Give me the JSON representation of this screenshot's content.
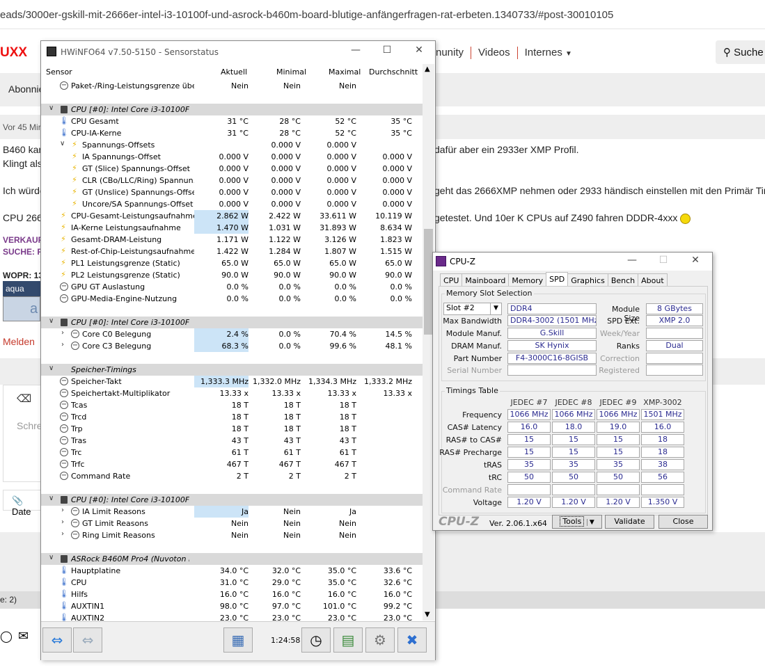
{
  "browser": {
    "url": "eads/3000er-gskill-mit-2666er-intel-i3-10100f-und-asrock-b460m-board-blutige-anfängerfragen-rat-erbeten.1340733/#post-30010105"
  },
  "site": {
    "logo": "UXX",
    "nav": [
      "nunity",
      "Videos",
      "Internes"
    ],
    "search_label": "Suche",
    "abonnie": "Abonnie",
    "post_meta": "Vor 45 Mir",
    "p1a": "B460 kan",
    "p1b": "dafür aber ein 2933er XMP Profil.",
    "p2": "Klingt als",
    "p3a": "Ich würde",
    "p3b": "geht das 2666XMP nehmen oder 2933 händisch einstellen mit den Primär Tim",
    "p4a": "CPU 2666",
    "p4b": "getestet. Und 10er K CPUs auf Z490 fahren DDDR-4xxx",
    "verkauf": "VERKAUF:",
    "suche": "SUCHE: R",
    "wopr": "WOPR: 13",
    "badge": "aqua",
    "badge2": "a",
    "melden": "Melden",
    "schre": "Schre",
    "date": "Date",
    "count": "e: 2)"
  },
  "hwinfo": {
    "title": "HWiNFO64 v7.50-5150 - Sensorstatus",
    "columns": [
      "Sensor",
      "Aktuell",
      "Minimal",
      "Maximal",
      "Durchschnitt"
    ],
    "rows": [
      {
        "t": "min",
        "n": "Paket-/Ring-Leistungsgrenze übe...",
        "v": [
          "Nein",
          "Nein",
          "Nein",
          ""
        ]
      },
      {
        "t": "blank",
        "n": "",
        "v": [
          "",
          "",
          "",
          ""
        ]
      },
      {
        "t": "grp",
        "n": "CPU [#0]: Intel Core i3-10100F: ...",
        "v": [
          "",
          "",
          "",
          ""
        ]
      },
      {
        "t": "th",
        "n": "CPU Gesamt",
        "v": [
          "31 °C",
          "28 °C",
          "52 °C",
          "35 °C"
        ]
      },
      {
        "t": "th",
        "n": "CPU-IA-Kerne",
        "v": [
          "31 °C",
          "28 °C",
          "52 °C",
          "35 °C"
        ]
      },
      {
        "t": "sub",
        "n": "Spannungs-Offsets",
        "v": [
          "",
          "0.000 V",
          "0.000 V",
          ""
        ]
      },
      {
        "t": "bolt2",
        "n": "IA Spannungs-Offset",
        "v": [
          "0.000 V",
          "0.000 V",
          "0.000 V",
          "0.000 V"
        ]
      },
      {
        "t": "bolt2",
        "n": "GT (Slice) Spannungs-Offset",
        "v": [
          "0.000 V",
          "0.000 V",
          "0.000 V",
          "0.000 V"
        ]
      },
      {
        "t": "bolt2",
        "n": "CLR (CBo/LLC/Ring) Spannun...",
        "v": [
          "0.000 V",
          "0.000 V",
          "0.000 V",
          "0.000 V"
        ]
      },
      {
        "t": "bolt2",
        "n": "GT (Unslice) Spannungs-Offset",
        "v": [
          "0.000 V",
          "0.000 V",
          "0.000 V",
          "0.000 V"
        ]
      },
      {
        "t": "bolt2",
        "n": "Uncore/SA Spannungs-Offset",
        "v": [
          "0.000 V",
          "0.000 V",
          "0.000 V",
          "0.000 V"
        ]
      },
      {
        "t": "bolt",
        "n": "CPU-Gesamt-Leistungsaufnahme",
        "v": [
          "2.862 W",
          "2.422 W",
          "33.611 W",
          "10.119 W"
        ],
        "hl": true
      },
      {
        "t": "bolt",
        "n": "IA-Kerne Leistungsaufnahme",
        "v": [
          "1.470 W",
          "1.031 W",
          "31.893 W",
          "8.634 W"
        ],
        "hl": true
      },
      {
        "t": "bolt",
        "n": "Gesamt-DRAM-Leistung",
        "v": [
          "1.171 W",
          "1.122 W",
          "3.126 W",
          "1.823 W"
        ]
      },
      {
        "t": "bolt",
        "n": "Rest-of-Chip-Leistungsaufnahme",
        "v": [
          "1.422 W",
          "1.284 W",
          "1.807 W",
          "1.515 W"
        ]
      },
      {
        "t": "bolt",
        "n": "PL1 Leistungsgrenze (Static)",
        "v": [
          "65.0 W",
          "65.0 W",
          "65.0 W",
          "65.0 W"
        ]
      },
      {
        "t": "bolt",
        "n": "PL2 Leistungsgrenze (Static)",
        "v": [
          "90.0 W",
          "90.0 W",
          "90.0 W",
          "90.0 W"
        ]
      },
      {
        "t": "min",
        "n": "GPU GT Auslastung",
        "v": [
          "0.0 %",
          "0.0 %",
          "0.0 %",
          "0.0 %"
        ]
      },
      {
        "t": "min",
        "n": "GPU-Media-Engine-Nutzung",
        "v": [
          "0.0 %",
          "0.0 %",
          "0.0 %",
          "0.0 %"
        ]
      },
      {
        "t": "blank",
        "n": "",
        "v": [
          "",
          "",
          "",
          ""
        ]
      },
      {
        "t": "grp",
        "n": "CPU [#0]: Intel Core i3-10100F: ...",
        "v": [
          "",
          "",
          "",
          ""
        ]
      },
      {
        "t": "submin",
        "n": "Core C0 Belegung",
        "v": [
          "2.4 %",
          "0.0 %",
          "70.4 %",
          "14.5 %"
        ],
        "hl": true
      },
      {
        "t": "submin",
        "n": "Core C3 Belegung",
        "v": [
          "68.3 %",
          "0.0 %",
          "99.6 %",
          "48.1 %"
        ],
        "hl": true
      },
      {
        "t": "blank",
        "n": "",
        "v": [
          "",
          "",
          "",
          ""
        ]
      },
      {
        "t": "grp2",
        "n": "Speicher-Timings",
        "v": [
          "",
          "",
          "",
          ""
        ]
      },
      {
        "t": "min",
        "n": "Speicher-Takt",
        "v": [
          "1,333.3 MHz",
          "1,332.0 MHz",
          "1,334.3 MHz",
          "1,333.2 MHz"
        ],
        "hl": true
      },
      {
        "t": "min",
        "n": "Speichertakt-Multiplikator",
        "v": [
          "13.33 x",
          "13.33 x",
          "13.33 x",
          "13.33 x"
        ]
      },
      {
        "t": "min",
        "n": "Tcas",
        "v": [
          "18 T",
          "18 T",
          "18 T",
          ""
        ]
      },
      {
        "t": "min",
        "n": "Trcd",
        "v": [
          "18 T",
          "18 T",
          "18 T",
          ""
        ]
      },
      {
        "t": "min",
        "n": "Trp",
        "v": [
          "18 T",
          "18 T",
          "18 T",
          ""
        ]
      },
      {
        "t": "min",
        "n": "Tras",
        "v": [
          "43 T",
          "43 T",
          "43 T",
          ""
        ]
      },
      {
        "t": "min",
        "n": "Trc",
        "v": [
          "61 T",
          "61 T",
          "61 T",
          ""
        ]
      },
      {
        "t": "min",
        "n": "Trfc",
        "v": [
          "467 T",
          "467 T",
          "467 T",
          ""
        ]
      },
      {
        "t": "min",
        "n": "Command Rate",
        "v": [
          "2 T",
          "2 T",
          "2 T",
          ""
        ]
      },
      {
        "t": "blank",
        "n": "",
        "v": [
          "",
          "",
          "",
          ""
        ]
      },
      {
        "t": "grp",
        "n": "CPU [#0]: Intel Core i3-10100F: ...",
        "v": [
          "",
          "",
          "",
          ""
        ]
      },
      {
        "t": "submin",
        "n": "IA Limit Reasons",
        "v": [
          "Ja",
          "Nein",
          "Ja",
          ""
        ],
        "hl": true
      },
      {
        "t": "submin",
        "n": "GT Limit Reasons",
        "v": [
          "Nein",
          "Nein",
          "Nein",
          ""
        ]
      },
      {
        "t": "submin",
        "n": "Ring Limit Reasons",
        "v": [
          "Nein",
          "Nein",
          "Nein",
          ""
        ]
      },
      {
        "t": "blank",
        "n": "",
        "v": [
          "",
          "",
          "",
          ""
        ]
      },
      {
        "t": "grp",
        "n": "ASRock B460M Pro4 (Nuvoton NC...",
        "v": [
          "",
          "",
          "",
          ""
        ]
      },
      {
        "t": "th",
        "n": "Hauptplatine",
        "v": [
          "34.0 °C",
          "32.0 °C",
          "35.0 °C",
          "33.6 °C"
        ]
      },
      {
        "t": "th",
        "n": "CPU",
        "v": [
          "31.0 °C",
          "29.0 °C",
          "35.0 °C",
          "32.6 °C"
        ]
      },
      {
        "t": "th",
        "n": "Hilfs",
        "v": [
          "16.0 °C",
          "16.0 °C",
          "16.0 °C",
          "16.0 °C"
        ]
      },
      {
        "t": "th",
        "n": "AUXTIN1",
        "v": [
          "98.0 °C",
          "97.0 °C",
          "101.0 °C",
          "99.2 °C"
        ]
      },
      {
        "t": "th",
        "n": "AUXTIN2",
        "v": [
          "23.0 °C",
          "23.0 °C",
          "23.0 °C",
          "23.0 °C"
        ]
      }
    ],
    "elapsed": "1:24:58"
  },
  "cpuz": {
    "title": "CPU-Z",
    "tabs": [
      "CPU",
      "Mainboard",
      "Memory",
      "SPD",
      "Graphics",
      "Bench",
      "About"
    ],
    "active_tab": "SPD",
    "slot_group": "Memory Slot Selection",
    "slot": "Slot #2",
    "type": "DDR4",
    "module_size_label": "Module Size",
    "module_size": "8 GBytes",
    "max_bw_label": "Max Bandwidth",
    "max_bw": "DDR4-3002 (1501 MHz)",
    "spd_ext_label": "SPD Ext.",
    "spd_ext": "XMP 2.0",
    "manuf_label": "Module Manuf.",
    "manuf": "G.Skill",
    "week_label": "Week/Year",
    "week": "",
    "dram_label": "DRAM Manuf.",
    "dram": "SK Hynix",
    "ranks_label": "Ranks",
    "ranks": "Dual",
    "part_label": "Part Number",
    "part": "F4-3000C16-8GISB",
    "corr_label": "Correction",
    "corr": "",
    "serial_label": "Serial Number",
    "serial": "",
    "reg_label": "Registered",
    "reg": "",
    "timings_group": "Timings Table",
    "timing_cols": [
      "JEDEC #7",
      "JEDEC #8",
      "JEDEC #9",
      "XMP-3002"
    ],
    "timing_rows": [
      {
        "l": "Frequency",
        "v": [
          "1066 MHz",
          "1066 MHz",
          "1066 MHz",
          "1501 MHz"
        ]
      },
      {
        "l": "CAS# Latency",
        "v": [
          "16.0",
          "18.0",
          "19.0",
          "16.0"
        ]
      },
      {
        "l": "RAS# to CAS#",
        "v": [
          "15",
          "15",
          "15",
          "18"
        ]
      },
      {
        "l": "RAS# Precharge",
        "v": [
          "15",
          "15",
          "15",
          "18"
        ]
      },
      {
        "l": "tRAS",
        "v": [
          "35",
          "35",
          "35",
          "38"
        ]
      },
      {
        "l": "tRC",
        "v": [
          "50",
          "50",
          "50",
          "56"
        ]
      },
      {
        "l": "Command Rate",
        "v": [
          "",
          "",
          "",
          ""
        ],
        "dis": true
      },
      {
        "l": "Voltage",
        "v": [
          "1.20 V",
          "1.20 V",
          "1.20 V",
          "1.350 V"
        ]
      }
    ],
    "brand": "CPU-Z",
    "version": "Ver. 2.06.1.x64",
    "tools": "Tools",
    "validate": "Validate",
    "close": "Close"
  }
}
